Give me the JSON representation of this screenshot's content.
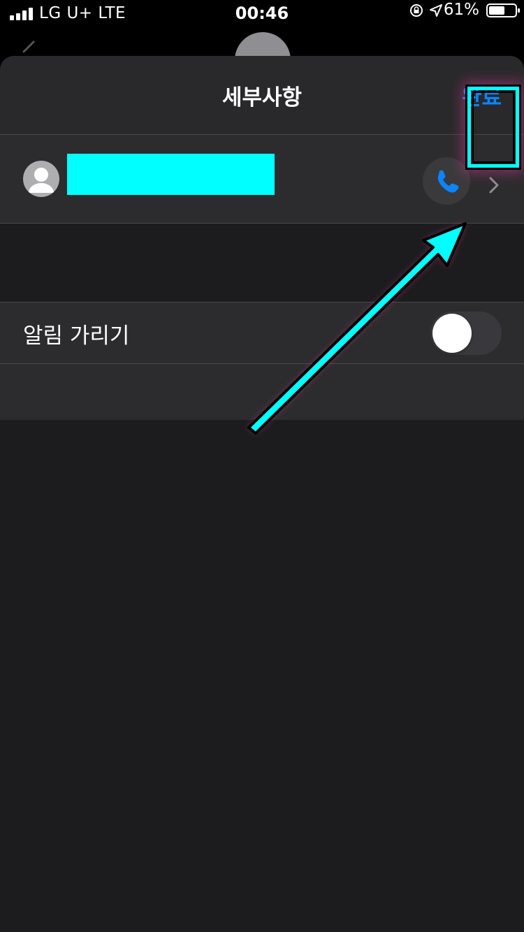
{
  "status_bar": {
    "carrier": "LG U+  LTE",
    "time": "00:46",
    "battery_percent": "61%",
    "battery_level": 0.61,
    "icons": [
      "signal-icon",
      "orientation-lock-icon",
      "location-icon",
      "battery-icon"
    ]
  },
  "nav": {
    "title": "세부사항",
    "done_label": "완료"
  },
  "contact": {
    "name": "",
    "avatar_icon": "person-icon",
    "call_icon": "phone-icon",
    "detail_icon": "chevron-right-icon"
  },
  "settings": {
    "hide_alerts_label": "알림 가리기",
    "hide_alerts_on": false
  },
  "colors": {
    "accent": "#0a84ff",
    "redaction": "#00ffff",
    "annotation_glow": "#ff3caa",
    "background": "#1c1c1e",
    "cell": "#2c2c2e"
  }
}
